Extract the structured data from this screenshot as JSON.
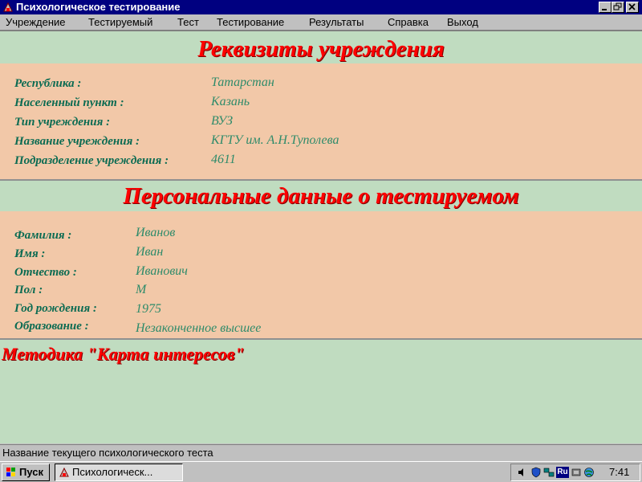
{
  "window": {
    "title": "Психологическое тестирование"
  },
  "menu": [
    "Учреждение",
    "Тестируемый",
    "Тест",
    "Тестирование",
    "Результаты",
    "Справка",
    "Выход"
  ],
  "institution": {
    "heading": "Реквизиты учреждения",
    "fields": [
      {
        "label": "Республика :",
        "value": "Татарстан"
      },
      {
        "label": "Населенный пункт :",
        "value": "Казань"
      },
      {
        "label": "Тип учреждения :",
        "value": "ВУЗ"
      },
      {
        "label": "Название учреждения :",
        "value": "КГТУ им. А.Н.Туполева"
      },
      {
        "label": "Подразделение учреждения :",
        "value": "4611"
      }
    ]
  },
  "person": {
    "heading": "Персональные данные о тестируемом",
    "fields": [
      {
        "label": "Фамилия :",
        "value": "Иванов"
      },
      {
        "label": "Имя :",
        "value": "Иван"
      },
      {
        "label": "Отчество :",
        "value": "Иванович"
      },
      {
        "label": "Пол :",
        "value": "М"
      },
      {
        "label": "Год рождения :",
        "value": "1975"
      },
      {
        "label": "Образование :",
        "value": "Незаконченное высшее"
      }
    ]
  },
  "method": {
    "title": "Методика \"Карта интересов\""
  },
  "statusbar": {
    "text": "Название текущего психологического теста"
  },
  "taskbar": {
    "start_label": "Пуск",
    "task_label": "Психологическ...",
    "tray_lang": "Ru",
    "clock": "7:41"
  },
  "colors": {
    "title_bar": "#000080",
    "heading_red": "#ff0000",
    "section_green": "#c0dcc0",
    "section_peach": "#f2c8a8",
    "label_green": "#0b6b52"
  }
}
